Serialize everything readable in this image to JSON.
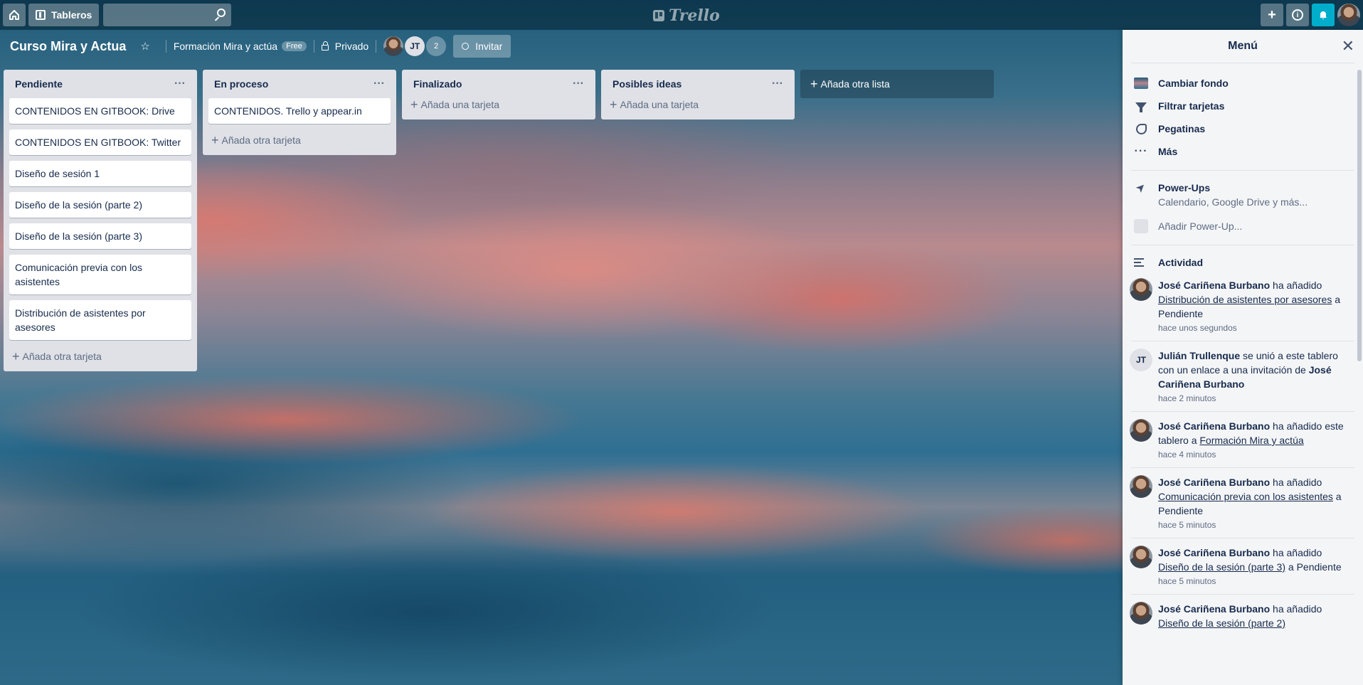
{
  "topbar": {
    "boards_label": "Tableros",
    "logo_text": "Trello",
    "search_placeholder": "",
    "icons": [
      "home-icon",
      "board-icon",
      "search-icon",
      "plus-icon",
      "info-icon",
      "bell-icon"
    ]
  },
  "board": {
    "title": "Curso Mira y Actua",
    "team": "Formación Mira y actúa",
    "team_badge": "Free",
    "visibility": "Privado",
    "member_initials": "JT",
    "member_count": "2",
    "invite_label": "Invitar"
  },
  "lists": [
    {
      "title": "Pendiente",
      "cards": [
        "CONTENIDOS EN GITBOOK: Drive",
        "CONTENIDOS EN GITBOOK: Twitter",
        "Diseño de sesión 1",
        "Diseño de la sesión (parte 2)",
        "Diseño de la sesión (parte 3)",
        "Comunicación previa con los asistentes",
        "Distribución de asistentes por asesores"
      ],
      "add_label": "Añada otra tarjeta"
    },
    {
      "title": "En proceso",
      "cards": [
        "CONTENIDOS. Trello y appear.in"
      ],
      "add_label": "Añada otra tarjeta"
    },
    {
      "title": "Finalizado",
      "cards": [],
      "add_label": "Añada una tarjeta"
    },
    {
      "title": "Posibles ideas",
      "cards": [],
      "add_label": "Añada una tarjeta"
    }
  ],
  "add_list_label": "Añada otra lista",
  "menu": {
    "title": "Menú",
    "items": [
      "Cambiar fondo",
      "Filtrar tarjetas",
      "Pegatinas",
      "Más"
    ],
    "powerups_title": "Power-Ups",
    "powerups_sub": "Calendario, Google Drive y más...",
    "add_powerup": "Añadir Power-Up...",
    "activity_title": "Actividad",
    "activity": [
      {
        "user": "José Cariñena Burbano",
        "pre": " ha añadido ",
        "link": "Distribución de asistentes por asesores",
        "post": " a Pendiente",
        "extra_user": "",
        "time": "hace unos segundos",
        "avatar": "photo"
      },
      {
        "user": "Julián Trullenque",
        "pre": " se unió a este tablero con un enlace a una invitación de ",
        "link": "",
        "post": "",
        "extra_user": "José Cariñena Burbano",
        "time": "hace 2 minutos",
        "avatar": "JT"
      },
      {
        "user": "José Cariñena Burbano",
        "pre": " ha añadido este tablero a ",
        "link": "Formación Mira y actúa",
        "post": "",
        "extra_user": "",
        "time": "hace 4 minutos",
        "avatar": "photo"
      },
      {
        "user": "José Cariñena Burbano",
        "pre": " ha añadido ",
        "link": "Comunicación previa con los asistentes",
        "post": " a Pendiente",
        "extra_user": "",
        "time": "hace 5 minutos",
        "avatar": "photo"
      },
      {
        "user": "José Cariñena Burbano",
        "pre": " ha añadido ",
        "link": "Diseño de la sesión (parte 3)",
        "post": " a Pendiente",
        "extra_user": "",
        "time": "hace 5 minutos",
        "avatar": "photo"
      },
      {
        "user": "José Cariñena Burbano",
        "pre": " ha añadido ",
        "link": "Diseño de la sesión (parte 2)",
        "post": "",
        "extra_user": "",
        "time": "",
        "avatar": "photo"
      }
    ]
  }
}
